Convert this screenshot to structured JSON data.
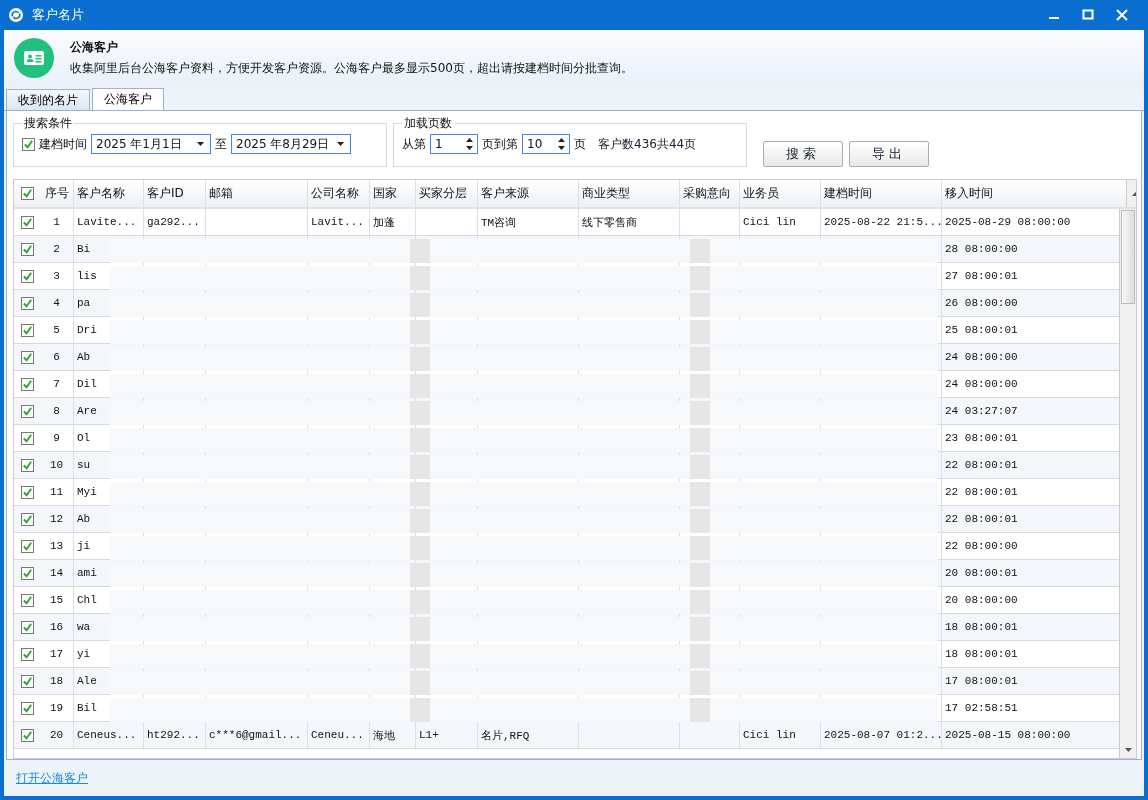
{
  "window": {
    "title": "客户名片"
  },
  "header": {
    "title": "公海客户",
    "description": "收集阿里后台公海客户资料，方便开发客户资源。公海客户最多显示500页，超出请按建档时间分批查询。"
  },
  "tabs": [
    {
      "label": "收到的名片",
      "selected": false
    },
    {
      "label": "公海客户",
      "selected": true
    }
  ],
  "search_conditions": {
    "legend": "搜索条件",
    "date_filter": {
      "label": "建档时间",
      "checked": true
    },
    "from_date": "2025 年1月1日",
    "to_label": "至",
    "to_date": "2025 年8月29日"
  },
  "load_pages": {
    "legend": "加载页数",
    "from_label": "从第",
    "from_value": "1",
    "to_label": "页到第",
    "to_value": "10",
    "unit": "页",
    "summary": "客户数436共44页"
  },
  "buttons": [
    "搜索",
    "导出"
  ],
  "table": {
    "select_all_checked": true,
    "columns": [
      "序号",
      "客户名称",
      "客户ID",
      "邮箱",
      "公司名称",
      "国家",
      "买家分层",
      "客户来源",
      "商业类型",
      "采购意向",
      "业务员",
      "建档时间",
      "移入时间"
    ],
    "rows": [
      {
        "checked": true,
        "masked": false,
        "no": "1",
        "name": "Lavite...",
        "customer_id": "ga292...",
        "company": "Lavit...",
        "country": "加蓬",
        "source": "TM咨询",
        "business_type": "线下零售商",
        "salesperson": "Cici lin",
        "created": "2025-08-22 21:5...",
        "moved": "2025-08-29 08:00:00"
      },
      {
        "checked": true,
        "masked": true,
        "no": "2",
        "name": "Bi",
        "moved": "28 08:00:00"
      },
      {
        "checked": true,
        "masked": true,
        "no": "3",
        "name": "lis",
        "moved": "27 08:00:01"
      },
      {
        "checked": true,
        "masked": true,
        "no": "4",
        "name": "pa",
        "moved": "26 08:00:00"
      },
      {
        "checked": true,
        "masked": true,
        "no": "5",
        "name": "Dri",
        "moved": "25 08:00:01"
      },
      {
        "checked": true,
        "masked": true,
        "no": "6",
        "name": "Ab",
        "moved": "24 08:00:00"
      },
      {
        "checked": true,
        "masked": true,
        "no": "7",
        "name": "Dil",
        "moved": "24 08:00:00"
      },
      {
        "checked": true,
        "masked": true,
        "no": "8",
        "name": "Are",
        "moved": "24 03:27:07"
      },
      {
        "checked": true,
        "masked": true,
        "no": "9",
        "name": "Ol",
        "moved": "23 08:00:01"
      },
      {
        "checked": true,
        "masked": true,
        "no": "10",
        "name": "su",
        "moved": "22 08:00:01"
      },
      {
        "checked": true,
        "masked": true,
        "no": "11",
        "name": "Myi",
        "moved": "22 08:00:01"
      },
      {
        "checked": true,
        "masked": true,
        "no": "12",
        "name": "Ab",
        "moved": "22 08:00:01"
      },
      {
        "checked": true,
        "masked": true,
        "no": "13",
        "name": "ji",
        "moved": "22 08:00:00"
      },
      {
        "checked": true,
        "masked": true,
        "no": "14",
        "name": "ami",
        "moved": "20 08:00:01"
      },
      {
        "checked": true,
        "masked": true,
        "no": "15",
        "name": "Chl",
        "moved": "20 08:00:00"
      },
      {
        "checked": true,
        "masked": true,
        "no": "16",
        "name": "wa",
        "moved": "18 08:00:01"
      },
      {
        "checked": true,
        "masked": true,
        "no": "17",
        "name": "yi",
        "moved": "18 08:00:01"
      },
      {
        "checked": true,
        "masked": true,
        "no": "18",
        "name": "Ale",
        "moved": "17 08:00:01"
      },
      {
        "checked": true,
        "masked": true,
        "no": "19",
        "name": "Bil",
        "moved": "17 02:58:51"
      },
      {
        "checked": true,
        "masked": false,
        "no": "20",
        "name": "Ceneus...",
        "customer_id": "ht292...",
        "email": "c***6@gmail...",
        "company": "Ceneu...",
        "country": "海地",
        "tier": "L1+",
        "source": "名片,RFQ",
        "salesperson": "Cici lin",
        "created": "2025-08-07 01:2...",
        "moved": "2025-08-15 08:00:00"
      }
    ]
  },
  "footer": {
    "link": "打开公海客户"
  }
}
